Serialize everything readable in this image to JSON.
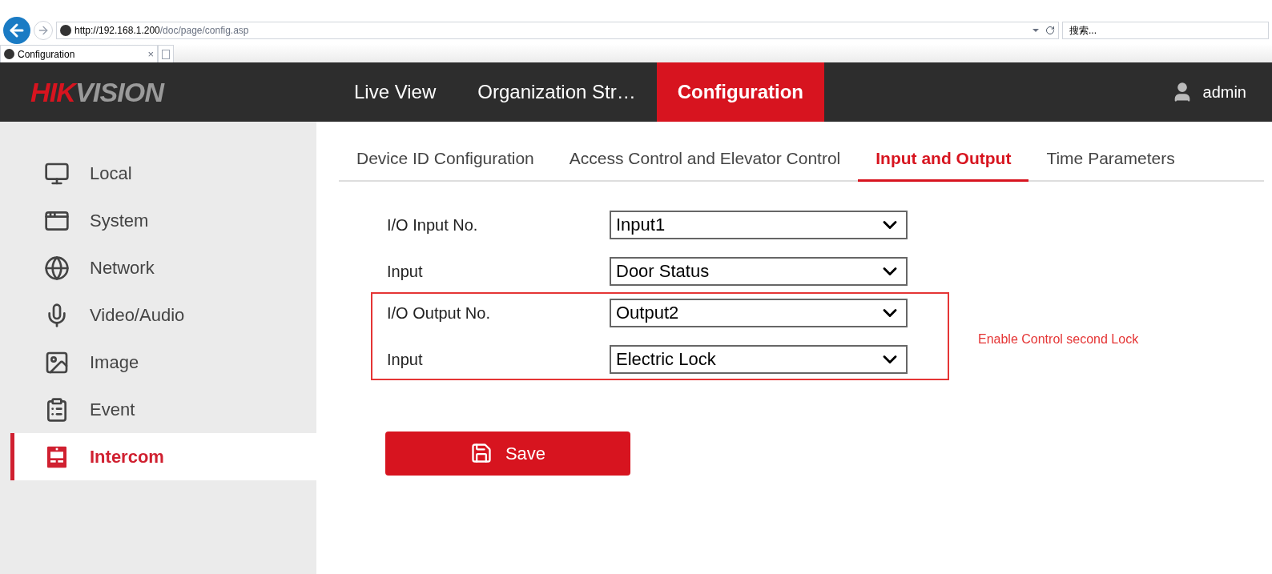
{
  "browser": {
    "address": {
      "host": "http://192.168.1.200",
      "path": "/doc/page/config.asp"
    },
    "search": {
      "placeholder": "搜索..."
    },
    "tab": {
      "title": "Configuration",
      "close": "×"
    }
  },
  "header": {
    "logo": [
      "HIK",
      "VISION"
    ],
    "nav": [
      {
        "label": "Live View",
        "selected": false
      },
      {
        "label": "Organization Str…",
        "selected": false
      },
      {
        "label": "Configuration",
        "selected": true
      }
    ],
    "user": "admin"
  },
  "sidebar": {
    "items": [
      {
        "label": "Local",
        "selected": false
      },
      {
        "label": "System",
        "selected": false
      },
      {
        "label": "Network",
        "selected": false
      },
      {
        "label": "Video/Audio",
        "selected": false
      },
      {
        "label": "Image",
        "selected": false
      },
      {
        "label": "Event",
        "selected": false
      },
      {
        "label": "Intercom",
        "selected": true
      }
    ]
  },
  "tabs": [
    {
      "label": "Device ID Configuration",
      "selected": false
    },
    {
      "label": "Access Control and Elevator Control",
      "selected": false
    },
    {
      "label": "Input and Output",
      "selected": true
    },
    {
      "label": "Time Parameters",
      "selected": false
    }
  ],
  "form": {
    "groups": [
      {
        "highlighted": false,
        "rows": [
          {
            "label": "I/O Input No.",
            "value": "Input1"
          },
          {
            "label": "Input",
            "value": "Door Status"
          }
        ]
      },
      {
        "highlighted": true,
        "note": "Enable Control second Lock",
        "rows": [
          {
            "label": "I/O Output No.",
            "value": "Output2"
          },
          {
            "label": "Input",
            "value": "Electric Lock"
          }
        ]
      }
    ]
  },
  "save_button": "Save"
}
